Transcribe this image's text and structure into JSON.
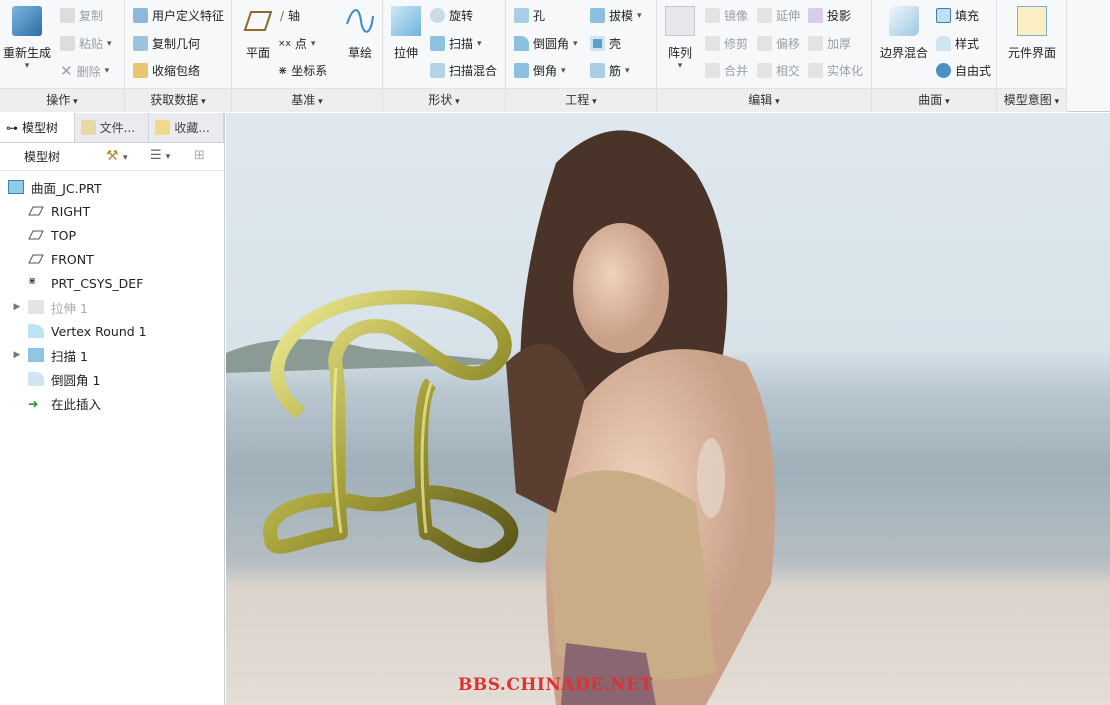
{
  "ribbon": {
    "groups": [
      {
        "label": "操作",
        "items": [
          "重新生成",
          "复制",
          "粘贴",
          "删除"
        ]
      },
      {
        "label": "获取数据",
        "items": [
          "用户定义特征",
          "复制几何",
          "收缩包络"
        ]
      },
      {
        "label": "基准",
        "items": [
          "平面",
          "轴",
          "点",
          "坐标系",
          "草绘"
        ]
      },
      {
        "label": "形状",
        "items": [
          "拉伸",
          "旋转",
          "扫描",
          "扫描混合"
        ]
      },
      {
        "label": "工程",
        "items": [
          "孔",
          "拔模",
          "倒圆角",
          "壳",
          "倒角",
          "筋"
        ]
      },
      {
        "label": "编辑",
        "items": [
          "阵列",
          "镜像",
          "延伸",
          "投影",
          "修剪",
          "偏移",
          "加厚",
          "合并",
          "相交",
          "实体化"
        ]
      },
      {
        "label": "曲面",
        "items": [
          "边界混合",
          "填充",
          "样式",
          "自由式"
        ]
      },
      {
        "label": "模型意图",
        "items": [
          "元件界面"
        ]
      }
    ]
  },
  "left_panel": {
    "tabs": [
      "模型树",
      "文件...",
      "收藏..."
    ],
    "header": "模型树",
    "tree": [
      "曲面_JC.PRT",
      "RIGHT",
      "TOP",
      "FRONT",
      "PRT_CSYS_DEF",
      "拉伸 1",
      "Vertex Round 1",
      "扫描 1",
      "倒圆角 1",
      "在此插入"
    ]
  },
  "viewport": {
    "watermark": "BBS.CHINADE.NET"
  }
}
